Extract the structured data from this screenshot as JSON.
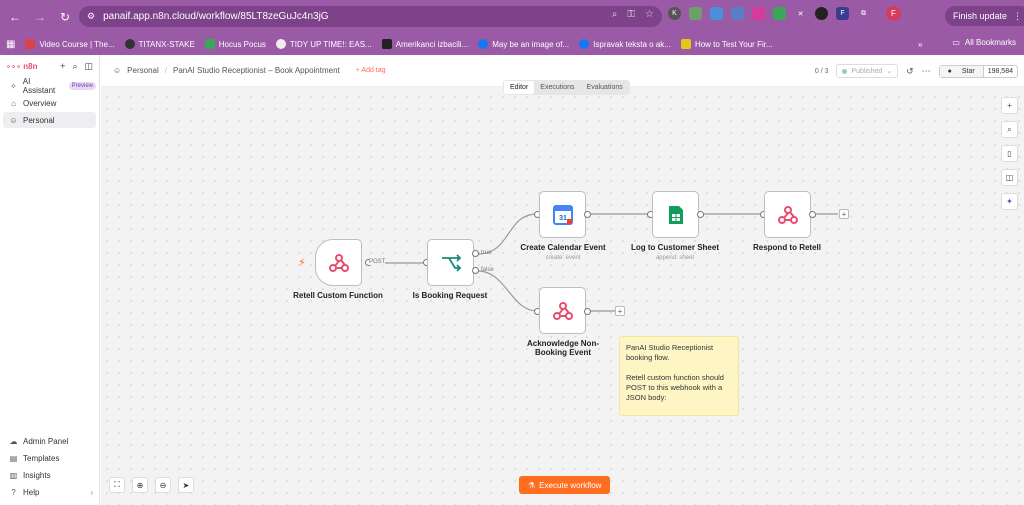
{
  "browser": {
    "url": "panaif.app.n8n.cloud/workflow/85LT8zeGuJc4n3jG",
    "update_label": "Finish update",
    "avatar_letter": "F"
  },
  "bookmarks": {
    "items": [
      "Video Course | The...",
      "TITANX-STAKE",
      "Hocus Pocus",
      "TIDY UP TIME!: EAS...",
      "Amerikanci izbacili...",
      "May be an image of...",
      "Ispravak teksta o ak...",
      "How to Test Your Fir..."
    ],
    "all_label": "All Bookmarks"
  },
  "sidebar": {
    "logo": "n8n",
    "items": [
      {
        "label": "AI Assistant",
        "badge": "Preview"
      },
      {
        "label": "Overview"
      },
      {
        "label": "Personal"
      }
    ],
    "bottom": [
      {
        "label": "Admin Panel"
      },
      {
        "label": "Templates"
      },
      {
        "label": "Insights"
      },
      {
        "label": "Help"
      }
    ]
  },
  "header": {
    "project": "Personal",
    "workflow_name": "PanAI Studio Receptionist – Book Appointment",
    "add_tag": "+ Add tag",
    "count": "0 / 3",
    "publish_label": "Published",
    "star_label": "Star",
    "star_count": "198,584"
  },
  "tabs": [
    "Editor",
    "Executions",
    "Evaluations"
  ],
  "nodes": {
    "retell": {
      "name": "Retell Custom Function"
    },
    "booking": {
      "name": "Is Booking Request"
    },
    "calendar": {
      "name": "Create Calendar Event",
      "sub": "create: event"
    },
    "sheet": {
      "name": "Log to Customer Sheet",
      "sub": "append: sheet"
    },
    "respond": {
      "name": "Respond to Retell"
    },
    "ack": {
      "name": "Acknowledge Non-Booking Event"
    }
  },
  "edge_labels": {
    "post": "POST",
    "true": "true",
    "false": "false"
  },
  "sticky_note": "PanAI Studio Receptionist booking flow.\n\nRetell custom function should POST to this webhook with a JSON body:",
  "execute_label": "Execute workflow",
  "colors": {
    "accent": "#ff6d1f",
    "brand": "#ea4b71",
    "chrome": "#9a5aa5"
  }
}
